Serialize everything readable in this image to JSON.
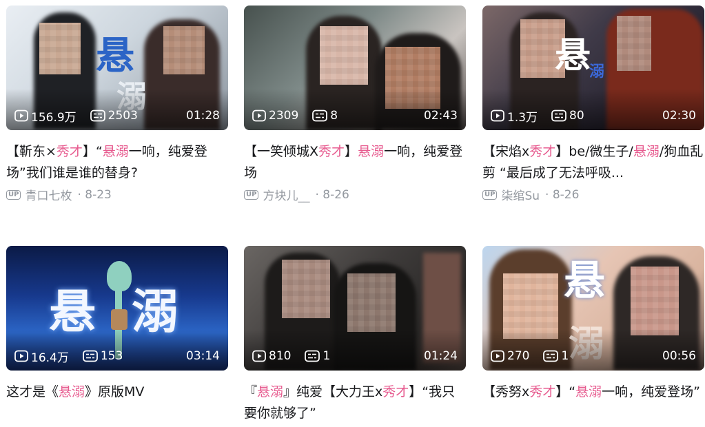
{
  "videos": [
    {
      "views": "156.9万",
      "danmaku": "2503",
      "duration": "01:28",
      "title_parts": [
        "【靳东×",
        "秀才",
        "】“",
        "悬溺",
        "一响，纯爱登场”我们谁是谁的替身?"
      ],
      "uploader": "青口七枚",
      "date": "· 8-23",
      "thumb_text": [
        "悬",
        "溺"
      ]
    },
    {
      "views": "2309",
      "danmaku": "8",
      "duration": "02:43",
      "title_parts": [
        "【一笑倾城X",
        "秀才",
        "】",
        "悬溺",
        "一响，纯爱登场"
      ],
      "uploader": "方块儿__",
      "date": "· 8-26"
    },
    {
      "views": "1.3万",
      "danmaku": "80",
      "duration": "02:30",
      "title_parts": [
        "【宋焰x",
        "秀才",
        "】be/微生子/",
        "悬溺",
        "/狗血乱剪 “最后成了无法呼吸..."
      ],
      "uploader": "柒绾Su",
      "date": "· 8-26",
      "thumb_text": [
        "悬",
        "溺"
      ]
    },
    {
      "views": "16.4万",
      "danmaku": "153",
      "duration": "03:14",
      "title_parts": [
        "这才是《",
        "悬溺",
        "》原版MV"
      ],
      "uploader": "",
      "date": "",
      "thumb_text": [
        "悬",
        "溺"
      ]
    },
    {
      "views": "810",
      "danmaku": "1",
      "duration": "01:24",
      "title_parts": [
        "『",
        "悬溺",
        "』纯爱【大力王x",
        "秀才",
        "】“我只要你就够了”"
      ],
      "uploader": "",
      "date": ""
    },
    {
      "views": "270",
      "danmaku": "1",
      "duration": "00:56",
      "title_parts": [
        "【秀努x",
        "秀才",
        "】“",
        "悬溺",
        "一响，纯爱登场”"
      ],
      "uploader": "",
      "date": "",
      "thumb_text": [
        "悬",
        "溺"
      ]
    }
  ],
  "highlight_color": "#e75b8f",
  "up_badge": "UP"
}
